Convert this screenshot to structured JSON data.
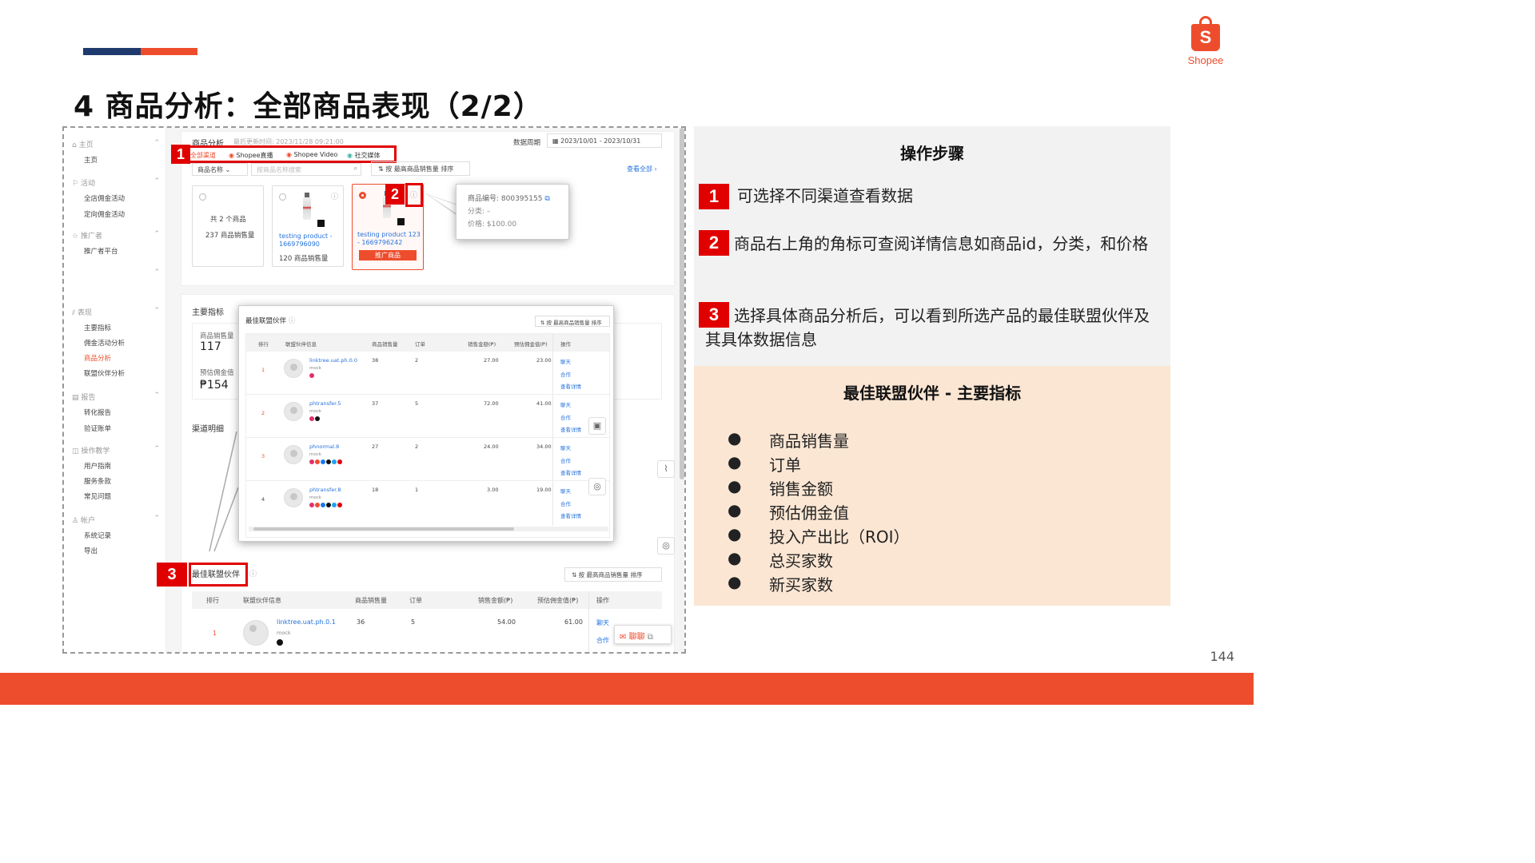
{
  "slide": {
    "title": "4 商品分析：全部商品表现（2/2）",
    "page_number": "144",
    "logo_text": "Shopee",
    "logo_letter": "S",
    "colors": {
      "accent": "#ee4d2d",
      "navy": "#1f3a6e",
      "badge_red": "#e10000"
    }
  },
  "steps": {
    "title": "操作步骤",
    "items": [
      {
        "num": "1",
        "text": "可选择不同渠道查看数据"
      },
      {
        "num": "2",
        "text": "商品右上角的角标可查阅详情信息如商品id，分类，和价格"
      },
      {
        "num": "3",
        "text": "选择具体商品分析后，可以看到所选产品的最佳联盟伙伴及其具体数据信息"
      }
    ]
  },
  "metrics": {
    "title": "最佳联盟伙伴 - 主要指标",
    "bullet_char": "●",
    "items": [
      "商品销售量",
      "订单",
      "销售金额",
      "预估佣金值",
      "投入产出比（ROI）",
      "总买家数",
      "新买家数"
    ]
  },
  "screenshot": {
    "sidebar": {
      "groups": [
        {
          "label": "主页",
          "items": [
            "主页"
          ]
        },
        {
          "label": "活动",
          "items": [
            "全店佣金活动",
            "定向佣金活动"
          ]
        },
        {
          "label": "推广者",
          "items": [
            "推广者平台"
          ]
        },
        {
          "label": "表现",
          "items": [
            "主要指标",
            "佣金活动分析",
            "商品分析",
            "联盟伙伴分析"
          ]
        },
        {
          "label": "报告",
          "items": [
            "转化报告",
            "验证账单"
          ]
        },
        {
          "label": "操作教学",
          "items": [
            "用户指南",
            "服务条款",
            "常见问题"
          ]
        },
        {
          "label": "帐户",
          "items": [
            "系统记录",
            "导出"
          ]
        }
      ],
      "active_item": "商品分析"
    },
    "header": {
      "title": "商品分析",
      "last_update": "最后更新时间: 2023/11/28 09:21:00",
      "period_label": "数据周期",
      "period_value": "2023/10/01 - 2023/10/31"
    },
    "channels": [
      "全部渠道",
      "Shopee直播",
      "Shopee Video",
      "社交媒体"
    ],
    "filter": {
      "select_value": "商品名称",
      "search_placeholder": "按商品名称搜索",
      "sort_label": "按 最高商品销售量 排序",
      "view_all": "查看全部 ›"
    },
    "products": {
      "summary_line1": "共 2 个商品",
      "summary_line2": "237 商品销售量",
      "p1_name": "testing product - 1669796090",
      "p1_sales": "120 商品销售量",
      "p2_name": "testing product 123 - 1669796242",
      "p2_button": "推广商品"
    },
    "tooltip": {
      "id_label": "商品编号: 800395155",
      "category": "分类: –",
      "price": "价格: $100.00"
    },
    "main_metrics": {
      "title": "主要指标",
      "sales_label": "商品销售量",
      "sales_value": "117",
      "commission_label": "预估佣金值",
      "commission_value": "₱154"
    },
    "channel_detail_title": "渠道明细",
    "popup": {
      "title": "最佳联盟伙伴",
      "sort_label": "按 最高商品销售量 排序",
      "columns": [
        "排行",
        "联盟伙伴信息",
        "商品销售量",
        "订单",
        "销售金额(₱)",
        "预估佣金值(₱)",
        "操作"
      ],
      "rows": [
        {
          "rank": "1",
          "name": "linktree.uat.ph.0.0",
          "sub": "mock",
          "sales": "38",
          "orders": "2",
          "amount": "27.00",
          "commission": "23.00"
        },
        {
          "rank": "2",
          "name": "phtransfer.5",
          "sub": "mock",
          "sales": "37",
          "orders": "5",
          "amount": "72.00",
          "commission": "41.00"
        },
        {
          "rank": "3",
          "name": "phnormal.8",
          "sub": "mock",
          "sales": "27",
          "orders": "2",
          "amount": "24.00",
          "commission": "34.00"
        },
        {
          "rank": "4",
          "name": "phtransfer.8",
          "sub": "mock",
          "sales": "18",
          "orders": "1",
          "amount": "3.00",
          "commission": "19.00"
        }
      ],
      "actions": [
        "聊天",
        "合作",
        "查看详情"
      ]
    },
    "best_partner": {
      "title": "最佳联盟伙伴",
      "sort_label": "按 最高商品销售量 排序",
      "columns": [
        "排行",
        "联盟伙伴信息",
        "商品销售量",
        "订单",
        "销售金额(₱)",
        "预估佣金值(₱)",
        "操作"
      ],
      "row": {
        "rank": "1",
        "name": "linktree.uat.ph.0.1",
        "sub": "mock",
        "sales": "36",
        "orders": "5",
        "amount": "54.00",
        "commission": "61.00"
      },
      "actions": [
        "聊天",
        "合作"
      ],
      "chat_button": "聊聊"
    },
    "badges": [
      "1",
      "2",
      "3"
    ]
  }
}
